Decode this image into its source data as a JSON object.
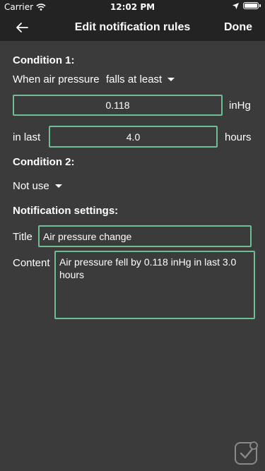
{
  "status_bar": {
    "carrier": "Carrier",
    "time": "12:02 PM"
  },
  "nav": {
    "title": "Edit notification rules",
    "done_label": "Done",
    "back_icon": "arrow-left-icon"
  },
  "condition1": {
    "heading": "Condition 1:",
    "prefix": "When air pressure",
    "operator": "falls at least",
    "value": "0.118",
    "unit": "inHg",
    "in_last_label": "in last",
    "duration": "4.0",
    "duration_unit": "hours"
  },
  "condition2": {
    "heading": "Condition 2:",
    "selection": "Not use"
  },
  "notification": {
    "heading": "Notification settings:",
    "title_label": "Title",
    "title_value": "Air pressure change",
    "content_label": "Content",
    "content_value": "Air pressure fell by 0.118 inHg in last 3.0 hours"
  },
  "colors": {
    "accent": "#6fbc95",
    "background": "#3b3b3b",
    "bar": "#232323"
  }
}
